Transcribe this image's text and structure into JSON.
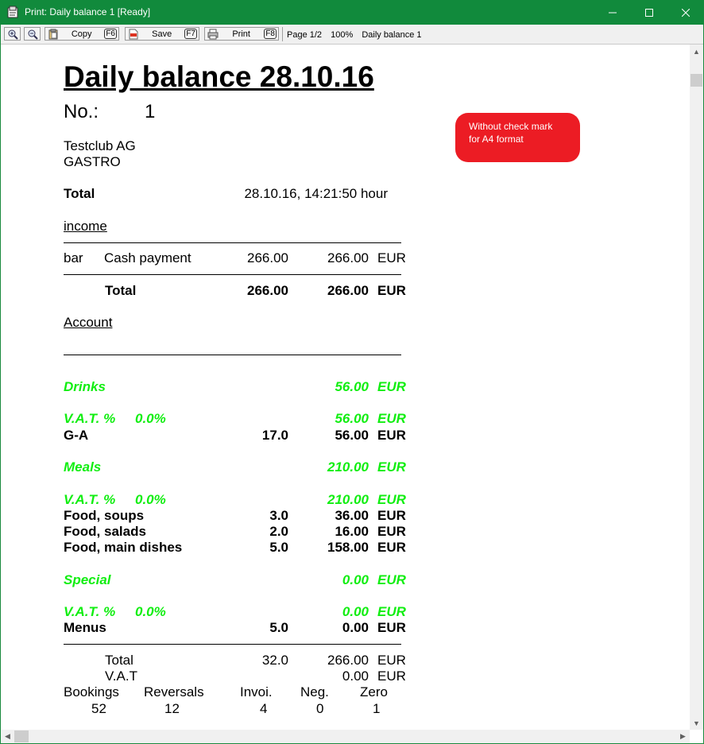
{
  "window": {
    "title": "Print: Daily balance 1 [Ready]",
    "minimize_icon": "minimize-icon",
    "maximize_icon": "maximize-icon",
    "close_icon": "close-icon"
  },
  "toolbar": {
    "copy_label": "Copy",
    "copy_key": "F6",
    "save_label": "Save",
    "save_key": "F7",
    "print_label": "Print",
    "print_key": "F8",
    "page": "Page 1/2",
    "zoom": "100%",
    "doc_name": "Daily balance 1"
  },
  "note": {
    "line1": "Without check mark",
    "line2": "for A4 format"
  },
  "report": {
    "title": "Daily balance 28.10.16",
    "no_label": "No.:",
    "no_value": "1",
    "company": "Testclub AG",
    "dept": "GASTRO",
    "total_label": "Total",
    "timestamp": "28.10.16, 14:21:50 hour",
    "income": {
      "heading": "income",
      "row": {
        "place": "bar",
        "type": "Cash payment",
        "amount1": "266.00",
        "amount2": "266.00",
        "currency": "EUR"
      },
      "total": {
        "label": "Total",
        "amount1": "266.00",
        "amount2": "266.00",
        "currency": "EUR"
      }
    },
    "account_heading": "Account",
    "groups": [
      {
        "name": "Drinks",
        "amount": "56.00",
        "currency": "EUR",
        "vat_label": "V.A.T. %",
        "vat_rate": "0.0%",
        "vat_amount": "56.00",
        "vat_currency": "EUR",
        "items": [
          {
            "name": "G-A",
            "qty": "17.0",
            "amount": "56.00",
            "currency": "EUR"
          }
        ]
      },
      {
        "name": "Meals",
        "amount": "210.00",
        "currency": "EUR",
        "vat_label": "V.A.T. %",
        "vat_rate": "0.0%",
        "vat_amount": "210.00",
        "vat_currency": "EUR",
        "items": [
          {
            "name": "Food, soups",
            "qty": "3.0",
            "amount": "36.00",
            "currency": "EUR"
          },
          {
            "name": "Food, salads",
            "qty": "2.0",
            "amount": "16.00",
            "currency": "EUR"
          },
          {
            "name": "Food, main dishes",
            "qty": "5.0",
            "amount": "158.00",
            "currency": "EUR"
          }
        ]
      },
      {
        "name": "Special",
        "amount": "0.00",
        "currency": "EUR",
        "vat_label": "V.A.T. %",
        "vat_rate": "0.0%",
        "vat_amount": "0.00",
        "vat_currency": "EUR",
        "items": [
          {
            "name": "Menus",
            "qty": "5.0",
            "amount": "0.00",
            "currency": "EUR"
          }
        ]
      }
    ],
    "summary": {
      "total_label": "Total",
      "total_qty": "32.0",
      "total_amount": "266.00",
      "total_currency": "EUR",
      "vat_label": "V.A.T",
      "vat_amount": "0.00",
      "vat_currency": "EUR"
    },
    "stats": {
      "headers": [
        "Bookings",
        "Reversals",
        "Invoi.",
        "Neg.",
        "Zero"
      ],
      "values": [
        "52",
        "12",
        "4",
        "0",
        "1"
      ]
    }
  }
}
